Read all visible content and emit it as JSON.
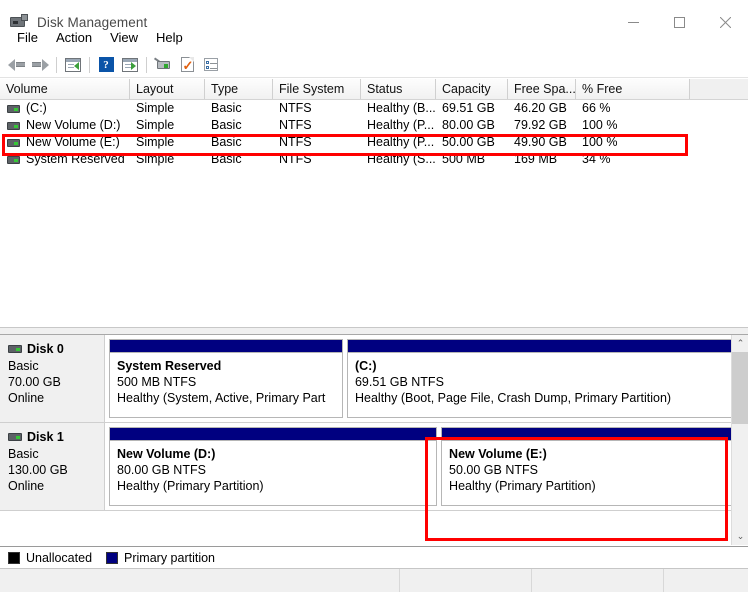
{
  "window": {
    "title": "Disk Management",
    "icon": "disk-management-icon",
    "controls": {
      "minimize": "–",
      "maximize": "□",
      "close": "✕"
    }
  },
  "menubar": {
    "items": [
      {
        "label": "File"
      },
      {
        "label": "Action"
      },
      {
        "label": "View"
      },
      {
        "label": "Help"
      }
    ]
  },
  "toolbar": {
    "buttons": [
      {
        "name": "back-icon"
      },
      {
        "name": "forward-icon"
      },
      {
        "name": "show-hide-console-tree-icon"
      },
      {
        "name": "help-icon"
      },
      {
        "name": "show-hide-action-pane-icon"
      },
      {
        "name": "rescan-disks-icon"
      },
      {
        "name": "properties-icon"
      },
      {
        "name": "list-view-icon"
      }
    ]
  },
  "volume_list": {
    "columns": [
      {
        "label": "Volume",
        "width": 130
      },
      {
        "label": "Layout",
        "width": 75
      },
      {
        "label": "Type",
        "width": 68
      },
      {
        "label": "File System",
        "width": 88
      },
      {
        "label": "Status",
        "width": 75
      },
      {
        "label": "Capacity",
        "width": 72
      },
      {
        "label": "Free Spa...",
        "width": 68
      },
      {
        "label": "% Free",
        "width": 114
      }
    ],
    "rows": [
      {
        "volume": "(C:)",
        "layout": "Simple",
        "type": "Basic",
        "file_system": "NTFS",
        "status": "Healthy (B...",
        "capacity": "69.51 GB",
        "free_space": "46.20 GB",
        "percent_free": "66 %",
        "highlighted": false
      },
      {
        "volume": "New Volume (D:)",
        "layout": "Simple",
        "type": "Basic",
        "file_system": "NTFS",
        "status": "Healthy (P...",
        "capacity": "80.00 GB",
        "free_space": "79.92 GB",
        "percent_free": "100 %",
        "highlighted": false
      },
      {
        "volume": "New Volume (E:)",
        "layout": "Simple",
        "type": "Basic",
        "file_system": "NTFS",
        "status": "Healthy (P...",
        "capacity": "50.00 GB",
        "free_space": "49.90 GB",
        "percent_free": "100 %",
        "highlighted": true
      },
      {
        "volume": "System Reserved",
        "layout": "Simple",
        "type": "Basic",
        "file_system": "NTFS",
        "status": "Healthy (S...",
        "capacity": "500 MB",
        "free_space": "169 MB",
        "percent_free": "34 %",
        "highlighted": false
      }
    ]
  },
  "graphical_view": {
    "disks": [
      {
        "name": "Disk 0",
        "type": "Basic",
        "size": "70.00 GB",
        "state": "Online",
        "partitions": [
          {
            "name": "System Reserved",
            "size_fs": "500 MB NTFS",
            "status": "Healthy (System, Active, Primary Part",
            "flex": 37,
            "highlighted": false
          },
          {
            "name": "(C:)",
            "size_fs": "69.51 GB NTFS",
            "status": "Healthy (Boot, Page File, Crash Dump, Primary Partition)",
            "flex": 63,
            "highlighted": false
          }
        ]
      },
      {
        "name": "Disk 1",
        "type": "Basic",
        "size": "130.00 GB",
        "state": "Online",
        "partitions": [
          {
            "name": "New Volume  (D:)",
            "size_fs": "80.00 GB NTFS",
            "status": "Healthy (Primary Partition)",
            "flex": 52,
            "highlighted": false
          },
          {
            "name": "New Volume  (E:)",
            "size_fs": "50.00 GB NTFS",
            "status": "Healthy (Primary Partition)",
            "flex": 48,
            "highlighted": true
          }
        ]
      }
    ],
    "scrollbar": {
      "up": "⌃",
      "down": "⌄"
    }
  },
  "legend": {
    "items": [
      {
        "label": "Unallocated",
        "color": "#000000"
      },
      {
        "label": "Primary partition",
        "color": "#000080"
      }
    ]
  },
  "colors": {
    "partition_bar": "#000080",
    "highlight": "#ff0000",
    "header_bg": "#f0f0f0"
  }
}
